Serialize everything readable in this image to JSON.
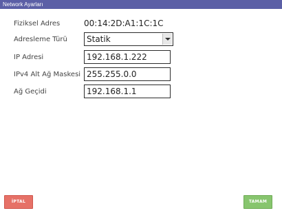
{
  "window": {
    "title": "Network Ayarları"
  },
  "form": {
    "physical_address_label": "Fiziksel Adres",
    "physical_address_value": "00:14:2D:A1:1C:1C",
    "addressing_type_label": "Adresleme Türü",
    "addressing_type_value": "Statik",
    "ip_label": "IP Adresi",
    "ip_value": "192.168.1.222",
    "subnet_label": "IPv4 Alt Ağ Maskesi",
    "subnet_value": "255.255.0.0",
    "gateway_label": "Ağ Geçidi",
    "gateway_value": "192.168.1.1"
  },
  "buttons": {
    "cancel_label": "İPTAL",
    "ok_label": "TAMAM"
  },
  "colors": {
    "titlebar": "#5b5fa6",
    "cancel": "#e67167",
    "ok": "#87c56e"
  },
  "icons": {
    "dropdown": "chevron-down-icon"
  }
}
